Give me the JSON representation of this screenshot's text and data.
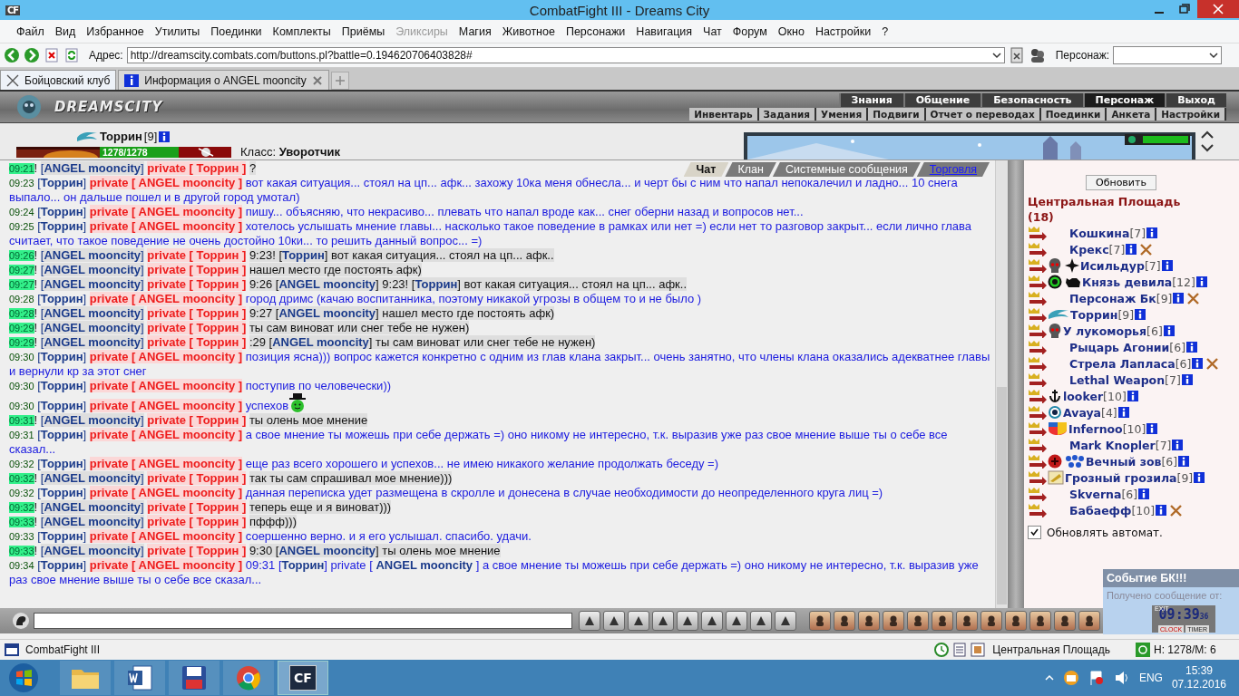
{
  "window": {
    "app_icon": "CF",
    "title": "CombatFight III - Dreams City"
  },
  "menu": [
    {
      "label": "Файл",
      "disabled": false
    },
    {
      "label": "Вид",
      "disabled": false
    },
    {
      "label": "Избранное",
      "disabled": false
    },
    {
      "label": "Утилиты",
      "disabled": false
    },
    {
      "label": "Поединки",
      "disabled": false
    },
    {
      "label": "Комплекты",
      "disabled": false
    },
    {
      "label": "Приёмы",
      "disabled": false
    },
    {
      "label": "Эликсиры",
      "disabled": true
    },
    {
      "label": "Магия",
      "disabled": false
    },
    {
      "label": "Животное",
      "disabled": false
    },
    {
      "label": "Персонажи",
      "disabled": false
    },
    {
      "label": "Навигация",
      "disabled": false
    },
    {
      "label": "Чат",
      "disabled": false
    },
    {
      "label": "Форум",
      "disabled": false
    },
    {
      "label": "Окно",
      "disabled": false
    },
    {
      "label": "Настройки",
      "disabled": false
    },
    {
      "label": "?",
      "disabled": false
    }
  ],
  "address_bar": {
    "label": "Адрес:",
    "url": "http://dreamscity.combats.com/buttons.pl?battle=0.194620706403828#",
    "character_label": "Персонаж:"
  },
  "tabs": [
    {
      "label": "Бойцовский клуб",
      "selected": true
    },
    {
      "label": "Информация о ANGEL mooncity",
      "selected": false
    }
  ],
  "game": {
    "logo": "DREAMSCITY",
    "nav": [
      {
        "label": "Знания",
        "selected": false
      },
      {
        "label": "Общение",
        "selected": false
      },
      {
        "label": "Безопасность",
        "selected": false
      },
      {
        "label": "Персонаж",
        "selected": true
      },
      {
        "label": "Выход",
        "selected": false
      }
    ],
    "subnav": [
      "Инвентарь",
      "Задания",
      "Умения",
      "Подвиги",
      "Отчет о переводах",
      "Поединки",
      "Анкета",
      "Настройки"
    ],
    "character": {
      "name": "Торрин",
      "lvl": "[9]",
      "hp": {
        "reading": "1278/1278",
        "level": 1
      },
      "class_label": "Класс:",
      "class": "Уворотчик"
    }
  },
  "chat_tabs": [
    {
      "label": "Чат",
      "selected": true,
      "kind": "tab"
    },
    {
      "label": "Клан",
      "selected": false,
      "kind": "tab"
    },
    {
      "label": "Системные сообщения",
      "selected": false,
      "kind": "tab"
    },
    {
      "label": "Торговля",
      "selected": false,
      "kind": "link"
    }
  ],
  "messages": [
    {
      "kind": "in",
      "time": "09:21",
      "mark": "!",
      "from": "[**ANGEL mooncity**]",
      "to": "private [ Торрин ]",
      "text": "?"
    },
    {
      "kind": "out",
      "time": "09:23",
      "from": "[**Торрин**]",
      "to": "private [ ANGEL mooncity ]",
      "text": "вот какая ситуация... стоял на цп... афк... захожу 10ка меня обнесла... и черт бы с ним что напал непокалечил и ладно... 10 снега выпало... он дальше пошел и в другой город умотал)"
    },
    {
      "kind": "out",
      "time": "09:24",
      "from": "[**Торрин**]",
      "to": "private [ ANGEL mooncity ]",
      "text": "пишу... объясняю, что некрасиво... плевать что напал вроде как... снег оберни назад и вопросов нет..."
    },
    {
      "kind": "out",
      "time": "09:25",
      "from": "[**Торрин**]",
      "to": "private [ ANGEL mooncity ]",
      "text": "хотелось услышать мнение главы... насколько такое поведение в рамках или нет =) если нет то разговор закрыт... если лично глава считает, что такое поведение не очень достойно 10ки... то решить данный вопрос... =)"
    },
    {
      "kind": "in",
      "time": "09:26",
      "mark": "!",
      "from": "[**ANGEL mooncity**]",
      "to": "private [ Торрин ]",
      "text": "9:23! [**Торрин**] вот какая ситуация... стоял на цп... афк.."
    },
    {
      "kind": "in",
      "time": "09:27",
      "mark": "!",
      "from": "[**ANGEL mooncity**]",
      "to": "private [ Торрин ]",
      "text": "нашел место где постоять афк)"
    },
    {
      "kind": "in",
      "time": "09:27",
      "mark": "!",
      "from": "[**ANGEL mooncity**]",
      "to": "private [ Торрин ]",
      "text": "9:26 [**ANGEL mooncity**] 9:23! [**Торрин**] вот какая ситуация... стоял на цп... афк.."
    },
    {
      "kind": "out",
      "time": "09:28",
      "from": "[**Торрин**]",
      "to": "private [ ANGEL mooncity ]",
      "text": "город дримс (качаю воспитанника, поэтому никакой угрозы в общем то и не было )"
    },
    {
      "kind": "in",
      "time": "09:28",
      "mark": "!",
      "from": "[**ANGEL mooncity**]",
      "to": "private [ Торрин ]",
      "text": "9:27 [**ANGEL mooncity**] нашел место где постоять афк)"
    },
    {
      "kind": "in",
      "time": "09:29",
      "mark": "!",
      "from": "[**ANGEL mooncity**]",
      "to": "private [ Торрин ]",
      "text": "ты сам виноват или снег тебе не нужен)"
    },
    {
      "kind": "in",
      "time": "09:29",
      "mark": "!",
      "from": "[**ANGEL mooncity**]",
      "to": "private [ Торрин ]",
      "text": ":29 [**ANGEL mooncity**] ты сам виноват или снег тебе не нужен)"
    },
    {
      "kind": "out",
      "time": "09:30",
      "from": "[**Торрин**]",
      "to": "private [ ANGEL mooncity ]",
      "text": "позиция ясна))) вопрос кажется конкретно с одним из глав клана закрыт... очень занятно, что члены клана оказались адекватнее главы и вернули кр за этот снег"
    },
    {
      "kind": "out",
      "time": "09:30",
      "from": "[**Торрин**]",
      "to": "private [ ANGEL mooncity ]",
      "text": "поступив по человечески))"
    },
    {
      "kind": "out",
      "time": "09:30",
      "from": "[**Торрин**]",
      "to": "private [ ANGEL mooncity ]",
      "text": "успехов",
      "emoticon": true
    },
    {
      "kind": "in",
      "time": "09:31",
      "mark": "!",
      "from": "[**ANGEL mooncity**]",
      "to": "private [ Торрин ]",
      "text": "ты олень мое мнение"
    },
    {
      "kind": "out",
      "time": "09:31",
      "from": "[**Торрин**]",
      "to": "private [ ANGEL mooncity ]",
      "text": "а свое мнение ты можешь при себе держать =) оно никому не интересно, т.к. выразив уже раз свое мнение выше ты о себе все сказал..."
    },
    {
      "kind": "out",
      "time": "09:32",
      "from": "[**Торрин**]",
      "to": "private [ ANGEL mooncity ]",
      "text": "еще раз всего хорошего и успехов... не имею никакого желание продолжать беседу =)"
    },
    {
      "kind": "in",
      "time": "09:32",
      "mark": "!",
      "from": "[**ANGEL mooncity**]",
      "to": "private [ Торрин ]",
      "text": "так ты сам спрашивал мое мнение)))"
    },
    {
      "kind": "out",
      "time": "09:32",
      "from": "[**Торрин**]",
      "to": "private [ ANGEL mooncity ]",
      "text": "данная переписка удет размещена в скролле и донесена в случае необходимости до неопределенного круга лиц =)"
    },
    {
      "kind": "in",
      "time": "09:32",
      "mark": "!",
      "from": "[**ANGEL mooncity**]",
      "to": "private [ Торрин ]",
      "text": "теперь еще и я виноват)))"
    },
    {
      "kind": "in",
      "time": "09:33",
      "mark": "!",
      "from": "[**ANGEL mooncity**]",
      "to": "private [ Торрин ]",
      "text": "пффф)))"
    },
    {
      "kind": "out",
      "time": "09:33",
      "from": "[**Торрин**]",
      "to": "private [ ANGEL mooncity ]",
      "text": "соершенно верно. и я его услышал. спасибо. удачи."
    },
    {
      "kind": "in",
      "time": "09:33",
      "mark": "!",
      "from": "[**ANGEL mooncity**]",
      "to": "private [ Торрин ]",
      "text": "9:30 [**ANGEL mooncity**] ты олень мое мнение"
    },
    {
      "kind": "out",
      "time": "09:34",
      "from": "[**Торрин**]",
      "to": "private [ ANGEL mooncity ]",
      "text": "09:31 [**Торрин**] private [ **ANGEL mooncity** ] а свое мнение ты можешь при себе держать =) оно никому не интересно, т.к. выразив уже раз свое мнение выше ты о себе все сказал..."
    }
  ],
  "players_panel": {
    "refresh": "Обновить",
    "location": "Центральная Площадь",
    "count": "(18)",
    "players": [
      {
        "name": "Кошкина",
        "lvl": "[7]",
        "injured": false
      },
      {
        "name": "Крекс",
        "lvl": "[7]",
        "injured": true
      },
      {
        "name": "Исильдур",
        "lvl": "[7]",
        "injured": false,
        "emblems": [
          {
            "kind": "skull"
          },
          {
            "kind": "star"
          }
        ]
      },
      {
        "name": "Князь девила",
        "lvl": "[12]",
        "injured": false,
        "emblems": [
          {
            "kind": "coin"
          },
          {
            "kind": "bull"
          }
        ]
      },
      {
        "name": "Персонаж Бк",
        "lvl": "[9]",
        "injured": true
      },
      {
        "name": "Торрин",
        "lvl": "[9]",
        "injured": false,
        "emblems": [
          {
            "kind": "dragon"
          }
        ]
      },
      {
        "name": "У лукоморья",
        "lvl": "[6]",
        "injured": false,
        "emblems": [
          {
            "kind": "skull"
          }
        ]
      },
      {
        "name": "Рыцарь Агонии",
        "lvl": "[6]",
        "injured": false
      },
      {
        "name": "Стрела Лапласа",
        "lvl": "[6]",
        "injured": true
      },
      {
        "name": "Lethal Weapon",
        "lvl": "[7]",
        "injured": false
      },
      {
        "name": "looker",
        "lvl": "[10]",
        "injured": false,
        "emblems": [
          {
            "kind": "anchor"
          }
        ]
      },
      {
        "name": "Avaya",
        "lvl": "[4]",
        "injured": false,
        "emblems": [
          {
            "kind": "target"
          }
        ]
      },
      {
        "name": "Infernoo",
        "lvl": "[10]",
        "injured": false,
        "emblems": [
          {
            "kind": "flag"
          }
        ]
      },
      {
        "name": "Mark Knopler",
        "lvl": "[7]",
        "injured": false
      },
      {
        "name": "Вечный зов",
        "lvl": "[6]",
        "injured": false,
        "emblems": [
          {
            "kind": "ball"
          },
          {
            "kind": "paws"
          }
        ]
      },
      {
        "name": "Грозный грозила",
        "lvl": "[9]",
        "injured": false,
        "emblems": [
          {
            "kind": "scroll"
          }
        ]
      },
      {
        "name": "Skverna",
        "lvl": "[6]",
        "injured": false
      },
      {
        "name": "Бабаефф",
        "lvl": "[10]",
        "injured": true
      }
    ],
    "auto_refresh": {
      "label": "Обновлять автомат.",
      "checked": true
    }
  },
  "notification": {
    "title": "Событие БК!!!",
    "text": "Получено сообщение от:"
  },
  "clock": {
    "exit": "EXIT",
    "time": "09:39",
    "seconds": "36",
    "buttons": [
      "CLOCK",
      "TIMER"
    ]
  },
  "status_bar": {
    "app": "CombatFight III",
    "location": "Центральная Площадь",
    "stats": "H: 1278/M: 6"
  },
  "taskbar": {
    "apps": [
      {
        "kind": "folder",
        "selected": false
      },
      {
        "kind": "word",
        "selected": false
      },
      {
        "kind": "floppy",
        "selected": false
      },
      {
        "kind": "browser",
        "selected": false
      },
      {
        "kind": "cf",
        "label": "CF",
        "selected": true
      }
    ],
    "language": "ENG",
    "time": "15:39",
    "date": "07.12.2016"
  }
}
